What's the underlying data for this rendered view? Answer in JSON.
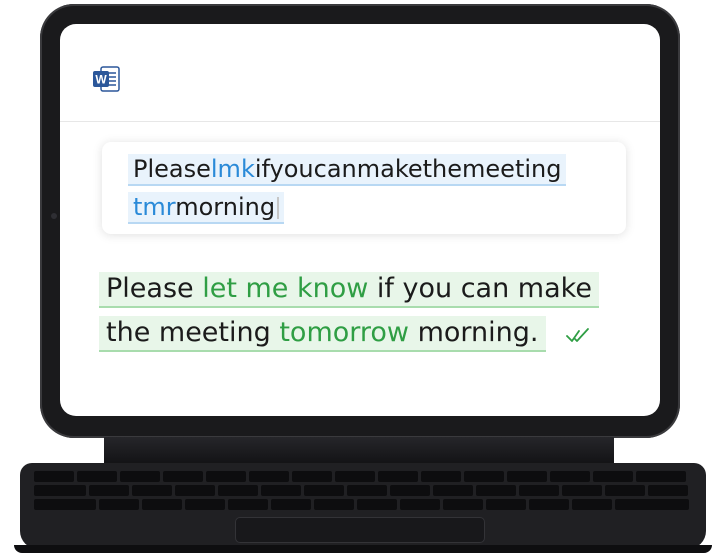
{
  "app": {
    "icon": "word-icon",
    "icon_letter": "W",
    "accent": "#2b579a"
  },
  "input": {
    "line1": [
      {
        "text": "Please",
        "abbr": false
      },
      {
        "text": "lmk",
        "abbr": true
      },
      {
        "text": "ifyoucanmakethemeeting",
        "abbr": false
      }
    ],
    "line2": [
      {
        "text": "tmr",
        "abbr": true
      },
      {
        "text": "morning",
        "abbr": false
      }
    ],
    "abbreviation_color": "#2a8ad8"
  },
  "output": {
    "line1": [
      {
        "text": "Please ",
        "expanded": false
      },
      {
        "text": "let me know",
        "expanded": true
      },
      {
        "text": " if you can make",
        "expanded": false
      }
    ],
    "line2": [
      {
        "text": "the meeting ",
        "expanded": false
      },
      {
        "text": "tomorrow",
        "expanded": true
      },
      {
        "text": " morning.",
        "expanded": false
      }
    ],
    "expanded_color": "#2f9e44",
    "status_icon": "double-check-icon"
  }
}
